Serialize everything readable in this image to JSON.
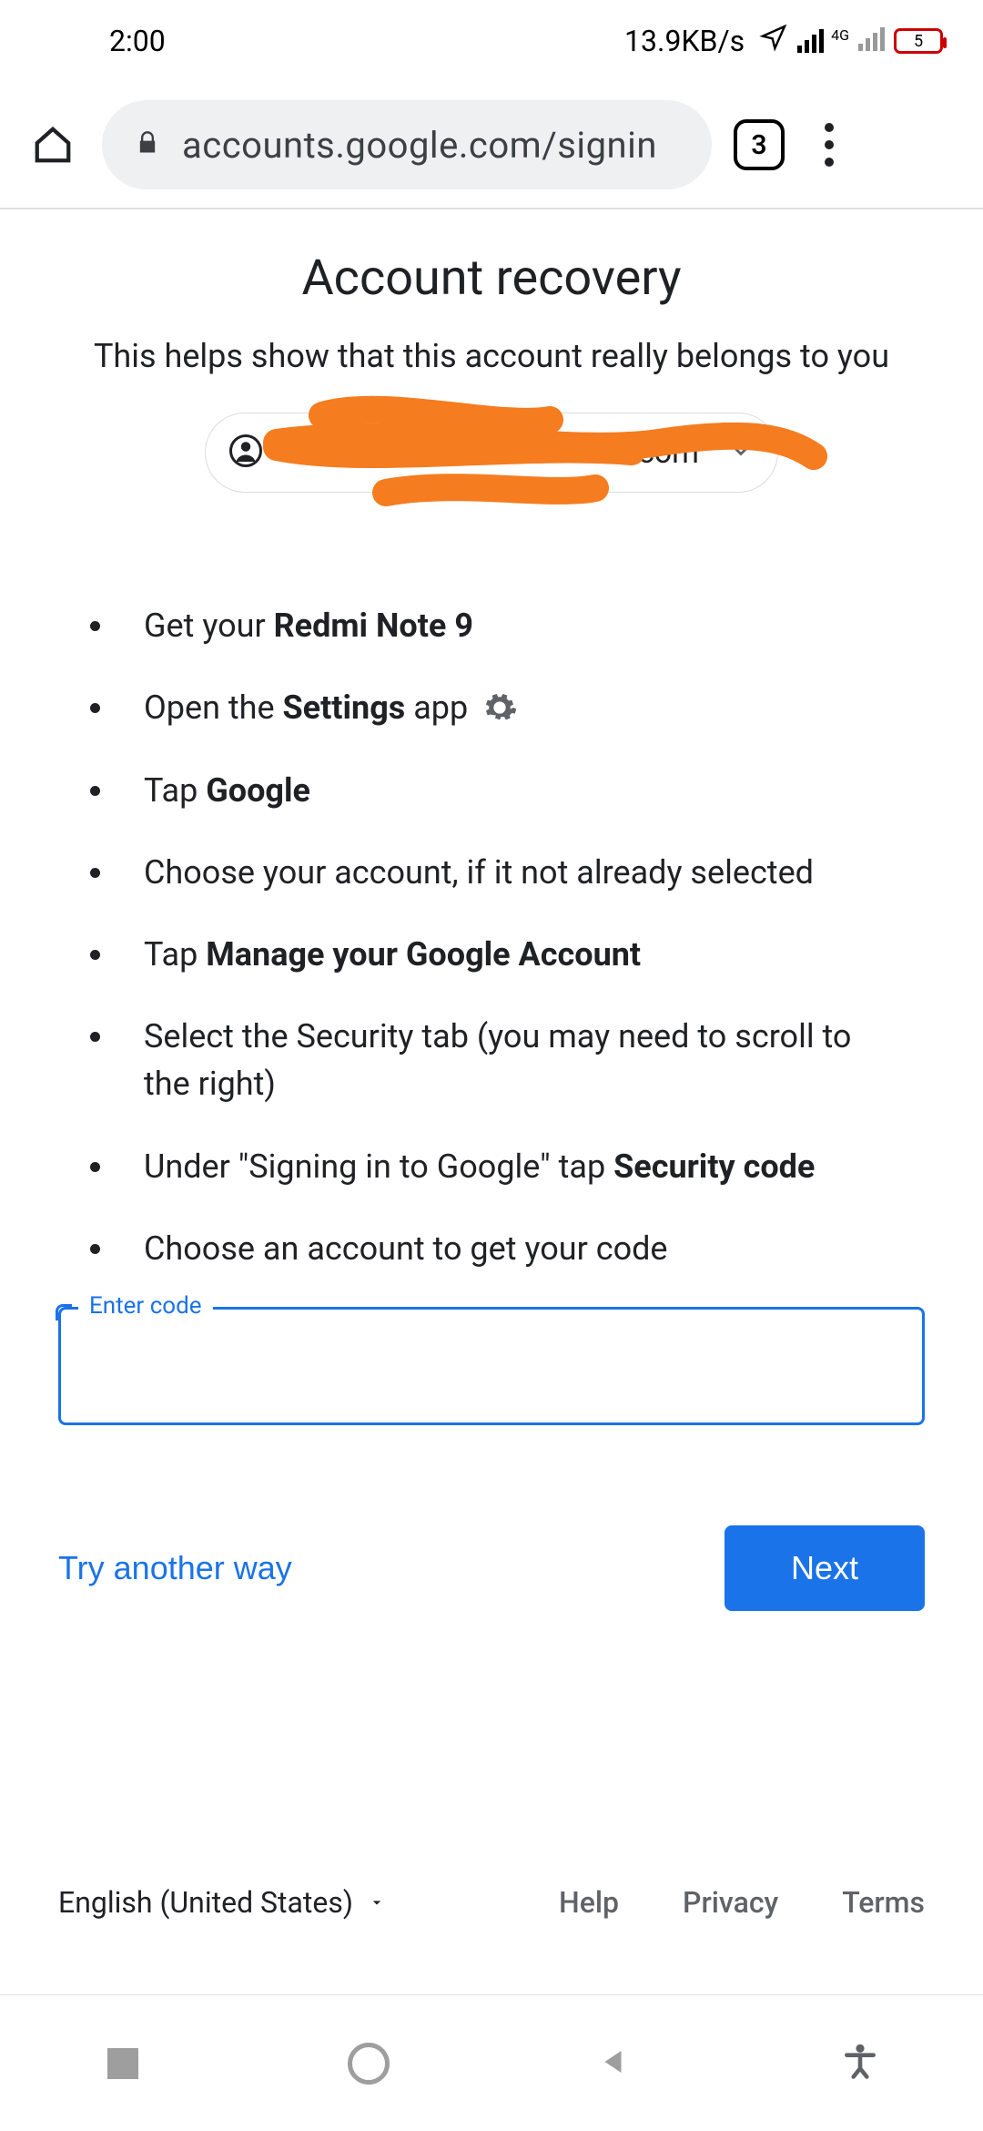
{
  "status": {
    "time": "2:00",
    "data_rate": "13.9KB/s",
    "net_label": "4G",
    "battery": "5"
  },
  "browser": {
    "url": "accounts.google.com/signin",
    "tab_count": "3"
  },
  "page": {
    "title": "Account recovery",
    "subtitle": "This helps show that this account really belongs to you",
    "chip_email_suffix": ".com"
  },
  "steps": {
    "s1a": "Get your ",
    "s1b": "Redmi Note 9",
    "s2a": "Open the ",
    "s2b": "Settings",
    "s2c": " app ",
    "s3a": "Tap ",
    "s3b": "Google",
    "s4": "Choose your account, if it not already selected",
    "s5a": "Tap ",
    "s5b": "Manage your Google Account",
    "s6": "Select the Security tab (you may need to scroll to the right)",
    "s7a": "Under \"Signing in to Google\" tap ",
    "s7b": "Security code",
    "s8": "Choose an account to get your code"
  },
  "form": {
    "code_label": "Enter code",
    "try_another": "Try another way",
    "next": "Next"
  },
  "footer": {
    "language": "English (United States)",
    "help": "Help",
    "privacy": "Privacy",
    "terms": "Terms"
  }
}
